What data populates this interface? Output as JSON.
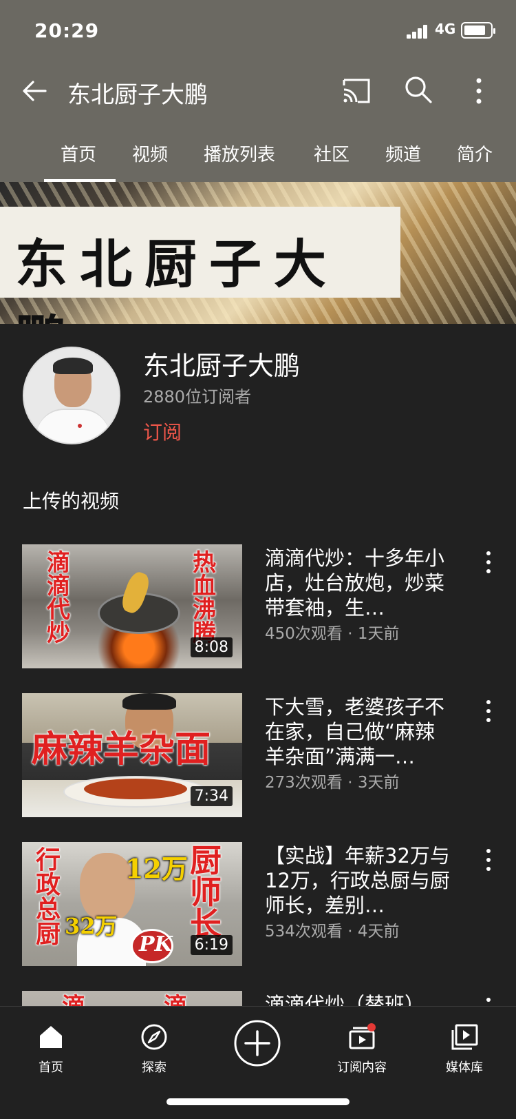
{
  "status": {
    "time": "20:29",
    "network": "4G"
  },
  "header": {
    "title": "东北厨子大鹏"
  },
  "tabs": [
    "首页",
    "视频",
    "播放列表",
    "社区",
    "频道",
    "简介"
  ],
  "banner": {
    "text": "东北厨子大鹏"
  },
  "channel": {
    "name": "东北厨子大鹏",
    "subscribers": "2880位订阅者",
    "subscribe_label": "订阅"
  },
  "section_title": "上传的视频",
  "videos": [
    {
      "title": "滴滴代炒：十多年小店，灶台放炮，炒菜带套袖，生…",
      "meta": "450次观看 · 1天前",
      "duration": "8:08",
      "thumb_text_left": "滴滴代炒",
      "thumb_text_right": "热血沸腾"
    },
    {
      "title": "下大雪，老婆孩子不在家，自己做“麻辣羊杂面”满满一…",
      "meta": "273次观看 · 3天前",
      "duration": "7:34",
      "thumb_text": "麻辣羊杂面"
    },
    {
      "title": "【实战】年薪32万与12万，行政总厨与厨师长，差别…",
      "meta": "534次观看 · 4天前",
      "duration": "6:19",
      "thumb_text_left": "行政总厨",
      "thumb_text_right": "厨师长",
      "thumb_12": "12万",
      "thumb_32": "32万",
      "thumb_pk": "PK"
    },
    {
      "title": "滴滴代炒（替班）",
      "meta": "",
      "duration": "",
      "thumb_text_left": "滴",
      "thumb_text_right": "滴"
    }
  ],
  "bottom_nav": [
    {
      "label": "首页",
      "icon": "home-icon"
    },
    {
      "label": "探索",
      "icon": "explore-icon"
    },
    {
      "label": "",
      "icon": "create-icon"
    },
    {
      "label": "订阅内容",
      "icon": "subscriptions-icon"
    },
    {
      "label": "媒体库",
      "icon": "library-icon"
    }
  ],
  "colors": {
    "header_bg": "#6b6962",
    "page_bg": "#212121",
    "subscribe": "#f0574a",
    "notification_dot": "#e53935"
  }
}
